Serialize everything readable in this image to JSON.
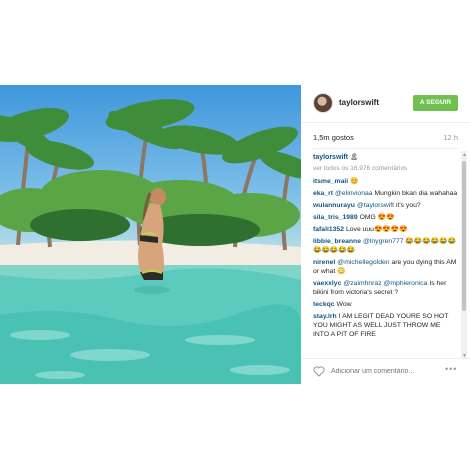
{
  "post": {
    "username": "taylorswift",
    "follow_label": "A SEGUIR",
    "likes": "1,5m gostos",
    "time": "12 h",
    "caption_user": "taylorswift",
    "caption_text": "🏝",
    "view_all": "ver todos os 16,976 comentários",
    "comments": [
      {
        "user": "itsme_maii",
        "text": "😊",
        "mention": ""
      },
      {
        "user": "eka_rt",
        "text": "Mungkin bkan dia wahahaa",
        "mention": "@elinvionaa"
      },
      {
        "user": "wulannurayu",
        "text": "it's you?",
        "mention": "@taylorswift"
      },
      {
        "user": "sila_tris_1989",
        "text": "OMG 😍😍",
        "mention": ""
      },
      {
        "user": "fafali1352",
        "text": "Love uuu😍😍😍😍",
        "mention": ""
      },
      {
        "user": "libbie_breanne",
        "text": "😂😂😂😂😂😂😂😂😂😂😂",
        "mention": "@lnygren777"
      },
      {
        "user": "nirenel",
        "text": "are you dying this AM or what 😳",
        "mention": "@michellegolden"
      },
      {
        "user": "vaexxlyc",
        "text": "Is her bikini from victoria's secret ?",
        "mention": "@zaimhnraz @mphieronica"
      },
      {
        "user": "teckqc",
        "text": "Wow",
        "mention": ""
      },
      {
        "user": "stay.lrh",
        "text": "I AM LEGIT DEAD YOURE SO HOT YOU MIGHT AS WELL JUST THROW ME INTO A PIT OF FIRE",
        "mention": ""
      }
    ],
    "comment_placeholder": "Adicionar um comentário...",
    "more_label": "•••"
  },
  "colors": {
    "accent_follow": "#70c050",
    "link": "#125688",
    "muted": "#999999"
  },
  "icons": [
    "heart-icon",
    "more-options-icon"
  ]
}
